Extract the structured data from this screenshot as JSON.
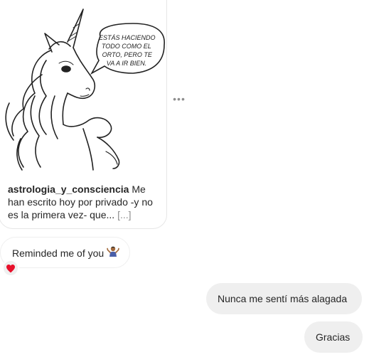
{
  "shared_post": {
    "illustration_speech": "ESTÁS HACIENDO TODO COMO EL ORTO, PERO TE VA A IR BIEN.",
    "speech_lines": [
      "ESTÁS HACIENDO",
      "TODO COMO EL",
      "ORTO, PERO TE",
      "VA A IR BIEN."
    ],
    "username": "astrologia_y_consciencia",
    "caption_text": "Me han escrito hoy por privado -y no es la primera vez- que...",
    "more_label": "[...]"
  },
  "message_options_icon": "more-horizontal-icon",
  "messages": [
    {
      "side": "received",
      "text": "Reminded me of you",
      "emoji_icon": "person-shrugging-icon"
    },
    {
      "side": "sent",
      "text": "Nunca me sentí más alagada"
    },
    {
      "side": "sent",
      "text": "Gracias"
    }
  ],
  "reaction": {
    "icon": "heart-icon",
    "color": "#e8102b"
  },
  "colors": {
    "sent_bubble": "#efefef",
    "border": "#e6e6e6",
    "muted": "#8e8e8e"
  }
}
